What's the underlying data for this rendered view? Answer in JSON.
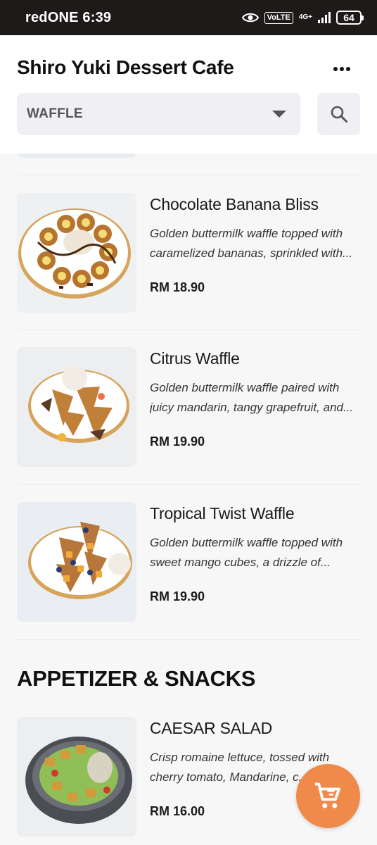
{
  "status_bar": {
    "carrier_time": "redONE 6:39",
    "volte": "VoLTE",
    "network": "4G+",
    "battery": "64"
  },
  "header": {
    "title": "Shiro Yuki Dessert Cafe",
    "category_selected": "WAFFLE"
  },
  "items": [
    {
      "name": "Chocolate Banana Bliss",
      "description": "Golden buttermilk waffle topped with caramelized bananas, sprinkled with...",
      "price": "RM 18.90"
    },
    {
      "name": "Citrus Waffle",
      "description": "Golden buttermilk waffle paired with juicy mandarin, tangy grapefruit, and...",
      "price": "RM 19.90"
    },
    {
      "name": "Tropical Twist Waffle",
      "description": "Golden buttermilk waffle topped with sweet mango cubes, a drizzle of...",
      "price": "RM 19.90"
    }
  ],
  "sections": [
    {
      "title": "APPETIZER & SNACKS"
    }
  ],
  "appetizer_items": [
    {
      "name": "CAESAR SALAD",
      "description": "Crisp romaine lettuce, tossed with cherry tomato, Mandarine, c...",
      "price": "RM 16.00"
    }
  ],
  "icons": {
    "more": "more-dots-icon",
    "dropdown": "chevron-down-icon",
    "search": "search-icon",
    "cart": "cart-icon"
  },
  "colors": {
    "accent": "#f08a4b",
    "status_bar": "#1f1a1a"
  }
}
